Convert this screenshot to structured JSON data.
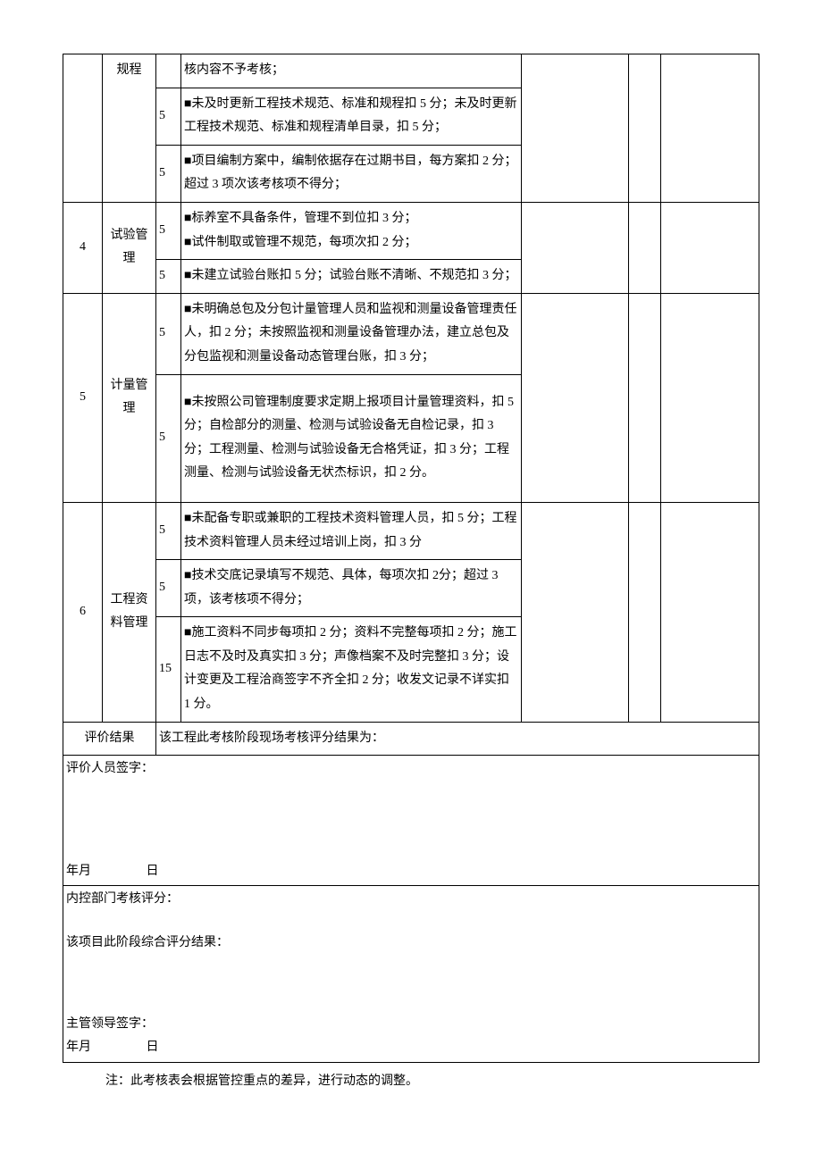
{
  "rows": [
    {
      "idx": "",
      "cat": "规程",
      "score": "",
      "desc": "核内容不予考核；"
    },
    {
      "idx": "",
      "cat": "",
      "score": "5",
      "desc": "■未及时更新工程技术规范、标准和规程扣 5 分；未及时更新工程技术规范、标准和规程清单目录，扣 5 分；"
    },
    {
      "idx": "",
      "cat": "",
      "score": "5",
      "desc": "■项目编制方案中，编制依据存在过期书目，每方案扣 2 分；超过 3 项次该考核项不得分；"
    },
    {
      "idx": "4",
      "cat": "试验管理",
      "score": "5",
      "desc": "■标养室不具备条件，管理不到位扣 3 分；\n■试件制取或管理不规范，每项次扣 2 分；"
    },
    {
      "idx": "",
      "cat": "",
      "score": "5",
      "desc": "■未建立试验台账扣 5 分；试验台账不清晰、不规范扣 3 分；"
    },
    {
      "idx": "5",
      "cat": "计量管理",
      "score": "5",
      "desc": "■未明确总包及分包计量管理人员和监视和测量设备管理责任人，扣 2 分；未按照监视和测量设备管理办法，建立总包及分包监视和测量设备动态管理台账，扣 3 分；"
    },
    {
      "idx": "",
      "cat": "",
      "score": "5",
      "desc": "■未按照公司管理制度要求定期上报项目计量管理资料，扣 5 分；自检部分的测量、检测与试验设备无自检记录，扣 3 分；工程测量、检测与试验设备无合格凭证，扣 3 分；工程测量、检测与试验设备无状杰标识，扣 2 分。"
    },
    {
      "idx": "6",
      "cat": "工程资料管理",
      "score": "5",
      "desc": "■未配备专职或兼职的工程技术资料管理人员，扣 5 分；工程技术资料管理人员未经过培训上岗，扣 3 分"
    },
    {
      "idx": "",
      "cat": "",
      "score": "5",
      "desc": "■技术交底记录填写不规范、具体，每项次扣 2分；超过 3 项，该考核项不得分；"
    },
    {
      "idx": "",
      "cat": "",
      "score": "15",
      "desc": "■施工资料不同步每项扣 2 分；资料不完整每项扣 2 分；施工日志不及时及真实扣 3 分；声像档案不及时完整扣 3 分；设计变更及工程洽商签字不齐全扣 2 分；收发文记录不详实扣 1 分。"
    }
  ],
  "eval": {
    "label": "评价结果",
    "text": "该工程此考核阶段现场考核评分结果为："
  },
  "sig1": {
    "line1": "评价人员签字：",
    "ym": "年月",
    "d": "日"
  },
  "sig2": {
    "line1": "内控部门考核评分：",
    "line2": "该项目此阶段综合评分结果：",
    "line3": "主管领导签字：",
    "ym": "年月",
    "d": "日"
  },
  "note": "注：此考核表会根据管控重点的差异，进行动态的调整。"
}
